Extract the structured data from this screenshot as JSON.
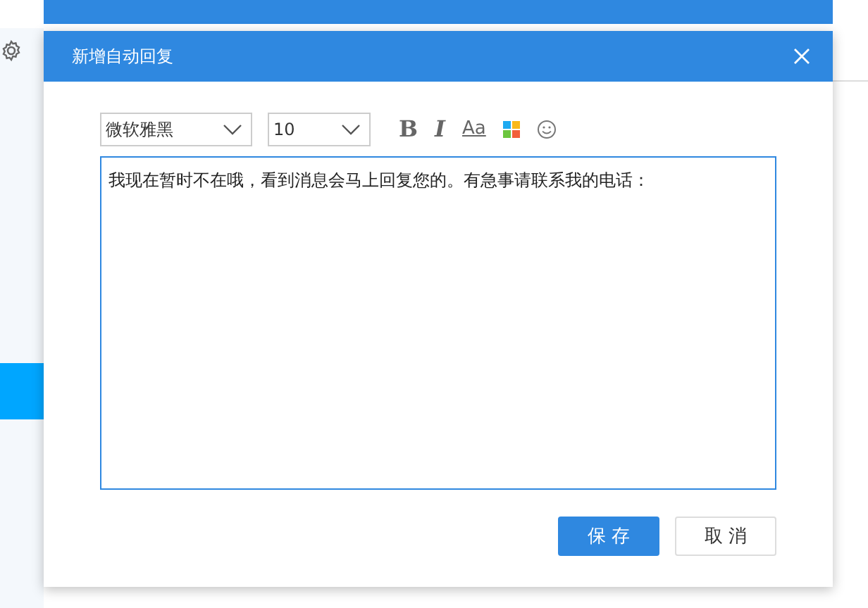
{
  "dialog": {
    "title": "新增自动回复",
    "font_select": {
      "value": "微软雅黑"
    },
    "size_select": {
      "value": "10"
    },
    "toolbar": [
      {
        "kind": "bold",
        "label": "B"
      },
      {
        "kind": "italic",
        "label": "I"
      },
      {
        "kind": "font-size",
        "label": "Aa"
      },
      {
        "kind": "color"
      },
      {
        "kind": "emoji"
      }
    ],
    "editor": {
      "value": "我现在暂时不在哦，看到消息会马上回复您的。有急事请联系我的电话："
    },
    "buttons": [
      {
        "kind": "primary",
        "label": "保 存"
      },
      {
        "kind": "secondary",
        "label": "取 消"
      }
    ]
  }
}
